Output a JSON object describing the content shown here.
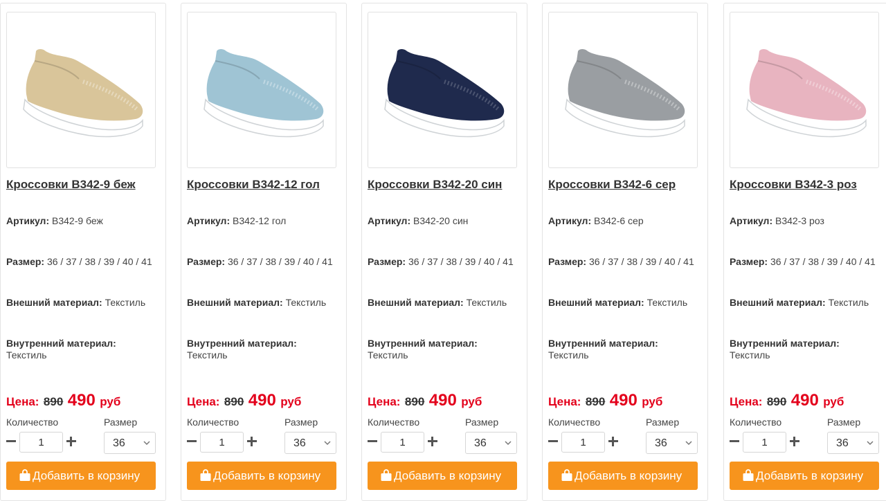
{
  "labels": {
    "article": "Артикул:",
    "size": "Размер:",
    "outer": "Внешний материал:",
    "inner": "Внутренний материал:",
    "price": "Цена:",
    "currency": "руб",
    "quantity": "Количество",
    "size_select": "Размер",
    "add_to_cart": "Добавить в корзину"
  },
  "products": [
    {
      "title": "Кроссовки B342-9 беж",
      "article": "B342-9 беж",
      "sizes": "36 / 37 / 38 / 39 / 40 / 41",
      "outer": "Текстиль",
      "inner": "Текстиль",
      "old_price": "890",
      "new_price": "490",
      "qty": "1",
      "size": "36",
      "color": "#d9c59a"
    },
    {
      "title": "Кроссовки B342-12 гол",
      "article": "B342-12 гол",
      "sizes": "36 / 37 / 38 / 39 / 40 / 41",
      "outer": "Текстиль",
      "inner": "Текстиль",
      "old_price": "890",
      "new_price": "490",
      "qty": "1",
      "size": "36",
      "color": "#9fc4d4"
    },
    {
      "title": "Кроссовки B342-20 син",
      "article": "B342-20 син",
      "sizes": "36 / 37 / 38 / 39 / 40 / 41",
      "outer": "Текстиль",
      "inner": "Текстиль",
      "old_price": "890",
      "new_price": "490",
      "qty": "1",
      "size": "36",
      "color": "#1f2a4d"
    },
    {
      "title": "Кроссовки B342-6 сер",
      "article": "B342-6 сер",
      "sizes": "36 / 37 / 38 / 39 / 40 / 41",
      "outer": "Текстиль",
      "inner": "Текстиль",
      "old_price": "890",
      "new_price": "490",
      "qty": "1",
      "size": "36",
      "color": "#9a9ea2"
    },
    {
      "title": "Кроссовки B342-3 роз",
      "article": "B342-3 роз",
      "sizes": "36 / 37 / 38 / 39 / 40 / 41",
      "outer": "Текстиль",
      "inner": "Текстиль",
      "old_price": "890",
      "new_price": "490",
      "qty": "1",
      "size": "36",
      "color": "#e8b4c0"
    }
  ],
  "colors": {
    "accent": "#f7941d",
    "price_red": "#e3001b"
  }
}
